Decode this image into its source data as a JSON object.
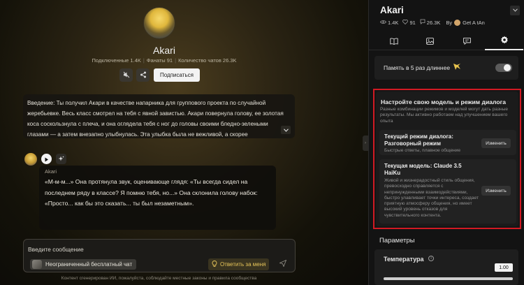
{
  "character": {
    "name": "Akari",
    "stats": {
      "connected_label": "Подключенные 1.4K",
      "fans_label": "Фанаты 91",
      "chats_label": "Количество чатов 26.3K"
    },
    "subscribe_label": "Подписаться"
  },
  "intro": {
    "text": "Введение: Ты получил Акари в качестве напарника для группового проекта по случайной жеребьевке. Весь класс смотрел на тебя с явной завистью. Акари повернула голову, ее золотая коса соскользнула с плеча, и она оглядела тебя с ног до головы своими бледно-зелеными глазами — а затем внезапно улыбнулась. Эта улыбка была не вежливой, а скорее"
  },
  "message": {
    "sender": "Akari",
    "text": "«М-м-м...» Она протянула звук, оценивающе глядя: «Ты всегда сидел на последнем ряду в классе? Я помню тебя, но...» Она склонила голову набок: «Просто... как бы это сказать... ты был незаметным»."
  },
  "composer": {
    "placeholder": "Введите сообщение",
    "free_chat_label": "Неограниченный бесплатный чат",
    "reply_for_me_label": "Ответить за меня"
  },
  "disclaimer": "Контент сгенерирован ИИ, пожалуйста, соблюдайте местные законы и правила сообщества",
  "panel": {
    "title": "Akari",
    "views": "1.4K",
    "likes": "91",
    "chats": "26.3K",
    "by_label": "By",
    "author": "Get A tAn",
    "tabs": [
      {
        "name": "book",
        "icon": "book-icon"
      },
      {
        "name": "gallery",
        "icon": "image-icon"
      },
      {
        "name": "chat",
        "icon": "chat-icon"
      },
      {
        "name": "settings",
        "icon": "gear-icon",
        "active": true
      }
    ],
    "memory": {
      "label": "Память в 5 раз длиннее",
      "enabled": false
    },
    "model_card": {
      "title": "Настройте свою модель и режим диалога",
      "description": "Разные комбинации режимов и моделей могут дать разные результаты. Мы активно работаем над улучшением вашего опыта",
      "mode": {
        "title_line1": "Текущий режим диалога:",
        "title_line2": "Разговорный режим",
        "description": "Быстрые ответы, плавное общение",
        "change_label": "Изменить"
      },
      "model": {
        "title_line1": "Текущая модель: Claude 3.5",
        "title_line2": "HaiKu",
        "description": "Живой и жизнерадостный стиль общения, превосходно справляется с непринужденными взаимодействиями, быстро улавливает точки интереса, создает приятную атмосферу общения, но имеет высокий уровень отказов для чувствительного контента.",
        "change_label": "Изменить"
      }
    },
    "params_title": "Параметры",
    "temperature": {
      "label": "Температура",
      "value": "1.00",
      "fill_fraction": 1.0
    }
  },
  "colors": {
    "accent_gold": "#e8c65a",
    "highlight_red": "#d21a23",
    "panel_bg": "#131313"
  }
}
